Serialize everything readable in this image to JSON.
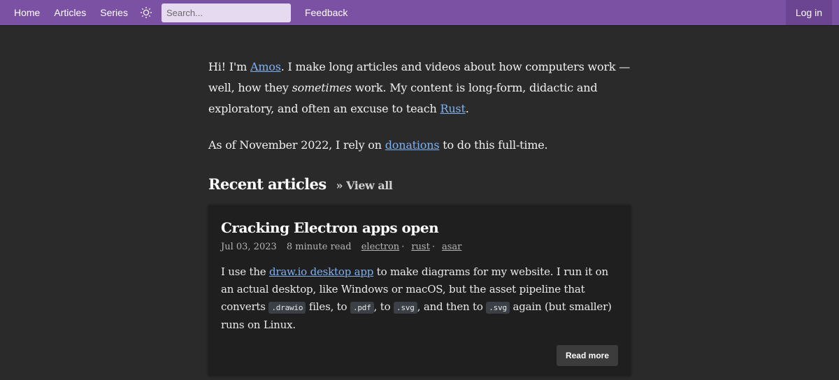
{
  "nav": {
    "home": "Home",
    "articles": "Articles",
    "series": "Series",
    "theme_icon": "sun-icon",
    "search_placeholder": "Search...",
    "search_value": "",
    "feedback": "Feedback",
    "login": "Log in"
  },
  "intro": {
    "p1_a": "Hi! I'm ",
    "p1_link": "Amos",
    "p1_b": ". I make long articles and videos about how computers work — well, how they ",
    "p1_em": "sometimes",
    "p1_c": " work. My content is long-form, didactic and exploratory, and often an excuse to teach ",
    "p1_link2": "Rust",
    "p1_d": ".",
    "p2_a": "As of November 2022, I rely on ",
    "p2_link": "donations",
    "p2_b": " to do this full-time."
  },
  "recent": {
    "heading": "Recent articles",
    "view_all": "» View all"
  },
  "article": {
    "title": "Cracking Electron apps open",
    "date": "Jul 03, 2023",
    "read_time": "8 minute read",
    "tags": [
      "electron",
      "rust",
      "asar"
    ],
    "excerpt_a": "I use the ",
    "excerpt_link": "draw.io desktop app",
    "excerpt_b": " to make diagrams for my website. I run it on an actual desktop, like Windows or macOS, but the asset pipeline that converts ",
    "code1": ".drawio",
    "excerpt_c": " files, to ",
    "code2": ".pdf",
    "excerpt_d": ", to ",
    "code3": ".svg",
    "excerpt_e": ", and then to ",
    "code4": ".svg",
    "excerpt_f": " again (but smaller) runs on Linux.",
    "read_more": "Read more"
  },
  "colors": {
    "topbar": "#7b51a3",
    "login_bg": "#6b4592",
    "page_bg": "#2a2a2a",
    "card_bg": "#1f1f1f",
    "link": "#7fb0f0"
  }
}
